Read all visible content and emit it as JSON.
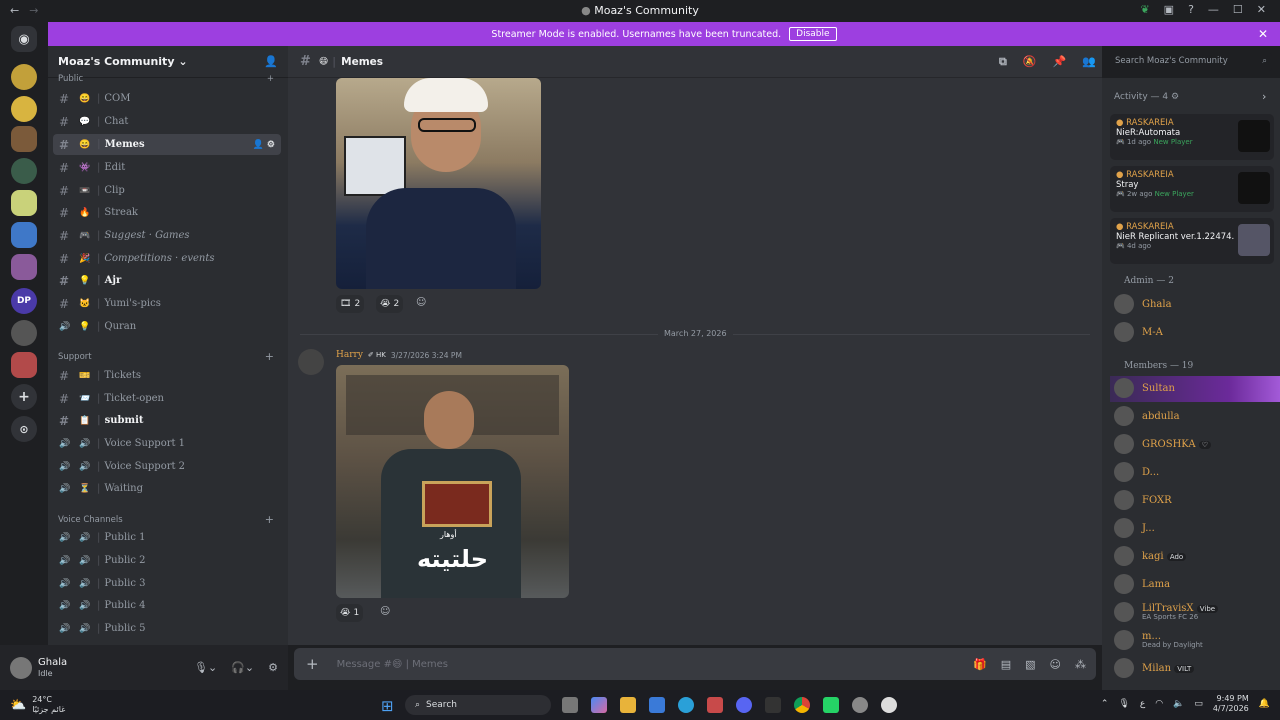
{
  "window": {
    "title": "Moaz's Community"
  },
  "banner": {
    "text": "Streamer Mode is enabled. Usernames have been truncated.",
    "button": "Disable"
  },
  "server": {
    "name": "Moaz's Community"
  },
  "categories": {
    "public": "Public",
    "support": "Support",
    "voice": "Voice Channels"
  },
  "channels": [
    {
      "label": "COM",
      "emoji": "😄",
      "type": "text"
    },
    {
      "label": "Chat",
      "emoji": "💬",
      "type": "text"
    },
    {
      "label": "Memes",
      "emoji": "😄",
      "type": "text"
    },
    {
      "label": "Edit",
      "emoji": "👾",
      "type": "text"
    },
    {
      "label": "Clip",
      "emoji": "📼",
      "type": "text"
    },
    {
      "label": "Streak",
      "emoji": "🔥",
      "type": "text"
    },
    {
      "label": "Suggest · Games",
      "emoji": "🎮",
      "type": "text"
    },
    {
      "label": "Competitions · events",
      "emoji": "🎉",
      "type": "text"
    },
    {
      "label": "Ajr",
      "emoji": "💡",
      "type": "text"
    },
    {
      "label": "Yumi's-pics",
      "emoji": "🐱",
      "type": "text"
    },
    {
      "label": "Quran",
      "emoji": "💡",
      "type": "voice"
    },
    {
      "label": "Tickets",
      "emoji": "🎫",
      "type": "text"
    },
    {
      "label": "Ticket-open",
      "emoji": "📨",
      "type": "text"
    },
    {
      "label": "submit",
      "emoji": "📋",
      "type": "text"
    },
    {
      "label": "Voice Support 1",
      "emoji": "🔊",
      "type": "voice"
    },
    {
      "label": "Voice Support 2",
      "emoji": "🔊",
      "type": "voice"
    },
    {
      "label": "Waiting",
      "emoji": "⏳",
      "type": "voice"
    },
    {
      "label": "Public 1",
      "emoji": "🔊",
      "type": "voice"
    },
    {
      "label": "Public 2",
      "emoji": "🔊",
      "type": "voice"
    },
    {
      "label": "Public 3",
      "emoji": "🔊",
      "type": "voice"
    },
    {
      "label": "Public 4",
      "emoji": "🔊",
      "type": "voice"
    },
    {
      "label": "Public 5",
      "emoji": "🔊",
      "type": "voice"
    }
  ],
  "user": {
    "name": "Ghala",
    "status": "Idle"
  },
  "channel_header": {
    "name": "Memes",
    "emoji": "😄"
  },
  "search": {
    "placeholder": "Search Moaz's Community"
  },
  "messages": {
    "reactions1": [
      {
        "emoji": "🎞",
        "count": "2"
      },
      {
        "emoji": "😭",
        "count": "2"
      }
    ],
    "date_divider": "March 27, 2026",
    "author": "Harry",
    "author_tag": "HK",
    "timestamp": "3/27/2026 3:24 PM",
    "caption_small": "أوهار",
    "caption_large": "حلتيته",
    "reactions2": [
      {
        "emoji": "😭",
        "count": "1"
      }
    ]
  },
  "composer": {
    "placeholder": "Message #😄 | Memes"
  },
  "activity": {
    "header": "Activity — 4",
    "items": [
      {
        "user": "RASKAREIA",
        "game": "NieR:Automata",
        "time": "1d ago",
        "badge": "New Player"
      },
      {
        "user": "RASKAREIA",
        "game": "Stray",
        "time": "2w ago",
        "badge": "New Player"
      },
      {
        "user": "RASKAREIA",
        "game": "NieR Replicant ver.1.22474...",
        "time": "4d ago",
        "badge": ""
      }
    ]
  },
  "admins": {
    "header": "Admin — 2",
    "list": [
      {
        "name": "Ghala",
        "color": "#e0a24a"
      },
      {
        "name": "M-A",
        "color": "#e0a24a"
      }
    ]
  },
  "members": {
    "header": "Members — 19",
    "list": [
      {
        "name": "Sultan",
        "tag": "",
        "sub": "",
        "color": "#e0a24a"
      },
      {
        "name": "abdulla",
        "tag": "",
        "sub": "",
        "color": "#e0a24a"
      },
      {
        "name": "GROSHKA",
        "tag": "♡",
        "sub": "",
        "color": "#e0a24a"
      },
      {
        "name": "D...",
        "tag": "",
        "sub": "",
        "color": "#e0a24a"
      },
      {
        "name": "FOXR",
        "tag": "",
        "sub": "",
        "color": "#e0a24a"
      },
      {
        "name": "J...",
        "tag": "",
        "sub": "",
        "color": "#e0a24a"
      },
      {
        "name": "kagi",
        "tag": "Ado",
        "sub": "",
        "color": "#e0a24a"
      },
      {
        "name": "Lama",
        "tag": "",
        "sub": "",
        "color": "#e0a24a"
      },
      {
        "name": "LilTravisX",
        "tag": "Vibe",
        "sub": "EA Sports FC 26",
        "color": "#e0a24a"
      },
      {
        "name": "m...",
        "tag": "",
        "sub": "Dead by Daylight",
        "color": "#e0a24a"
      },
      {
        "name": "Milan",
        "tag": "VILT",
        "sub": "",
        "color": "#e0a24a"
      }
    ]
  },
  "taskbar": {
    "weather_temp": "24°C",
    "weather_desc": "غائم جزئيًا",
    "search": "Search",
    "lang": "ع",
    "time": "9:49 PM",
    "date": "4/7/2026"
  },
  "colors": {
    "accent": "#9d3fe0",
    "bg": "#313338",
    "sidebar": "#2b2d31"
  }
}
